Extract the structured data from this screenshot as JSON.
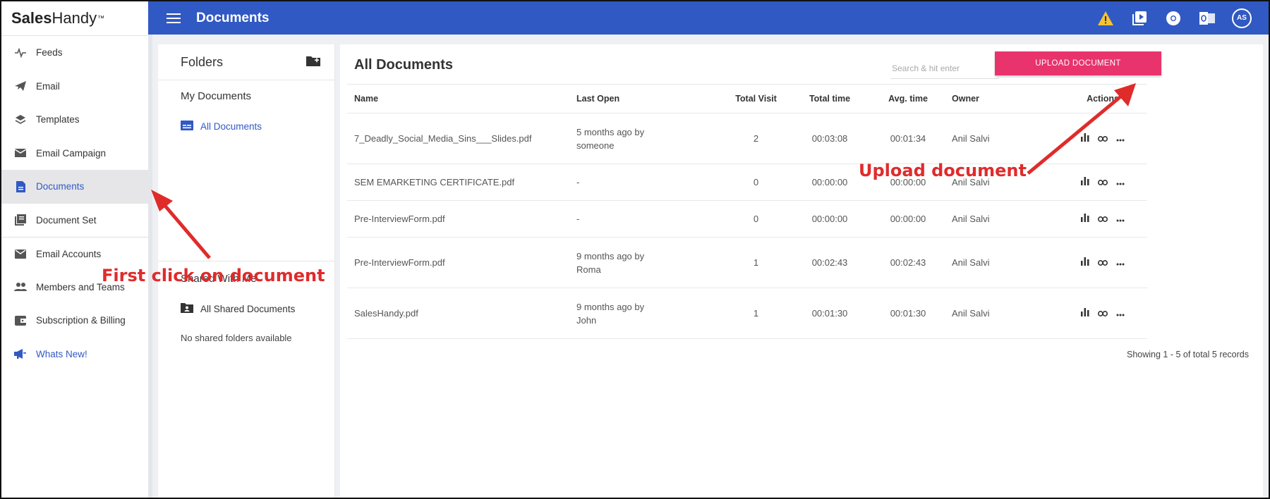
{
  "brand": {
    "bold": "Sales",
    "light": "Handy",
    "tm": "™"
  },
  "topbar": {
    "title": "Documents",
    "avatar": "AS"
  },
  "sidebar": {
    "items": [
      {
        "label": "Feeds"
      },
      {
        "label": "Email"
      },
      {
        "label": "Templates"
      },
      {
        "label": "Email Campaign"
      },
      {
        "label": "Documents"
      },
      {
        "label": "Document Set"
      },
      {
        "label": "Email Accounts"
      },
      {
        "label": "Members and Teams"
      },
      {
        "label": "Subscription & Billing"
      },
      {
        "label": "Whats New!"
      }
    ]
  },
  "folders": {
    "title": "Folders",
    "my_documents": "My Documents",
    "all_documents": "All Documents",
    "shared_with_me": "Shared With Me",
    "all_shared": "All Shared Documents",
    "no_shared": "No shared folders available"
  },
  "docs": {
    "title": "All Documents",
    "search_placeholder": "Search & hit enter",
    "upload_label": "UPLOAD DOCUMENT",
    "columns": [
      "Name",
      "Last Open",
      "Total Visit",
      "Total time",
      "Avg. time",
      "Owner",
      "Actions"
    ],
    "rows": [
      {
        "name": "7_Deadly_Social_Media_Sins___Slides.pdf",
        "last_open_1": "5 months ago by",
        "last_open_2": "someone",
        "visits": "2",
        "total": "00:03:08",
        "avg": "00:01:34",
        "owner": "Anil Salvi"
      },
      {
        "name": "SEM EMARKETING CERTIFICATE.pdf",
        "last_open_1": "-",
        "last_open_2": "",
        "visits": "0",
        "total": "00:00:00",
        "avg": "00:00:00",
        "owner": "Anil Salvi"
      },
      {
        "name": "Pre-InterviewForm.pdf",
        "last_open_1": "-",
        "last_open_2": "",
        "visits": "0",
        "total": "00:00:00",
        "avg": "00:00:00",
        "owner": "Anil Salvi"
      },
      {
        "name": "Pre-InterviewForm.pdf",
        "last_open_1": "9 months ago by",
        "last_open_2": "Roma",
        "visits": "1",
        "total": "00:02:43",
        "avg": "00:02:43",
        "owner": "Anil Salvi"
      },
      {
        "name": "SalesHandy.pdf",
        "last_open_1": "9 months ago by",
        "last_open_2": "John",
        "visits": "1",
        "total": "00:01:30",
        "avg": "00:01:30",
        "owner": "Anil Salvi"
      }
    ],
    "records": "Showing 1 - 5 of total 5 records"
  },
  "annotations": {
    "first": "First click on document",
    "upload": "Upload document"
  },
  "colors": {
    "primary": "#3059c4",
    "accent": "#e8336d",
    "annotation": "#e02b2b"
  }
}
